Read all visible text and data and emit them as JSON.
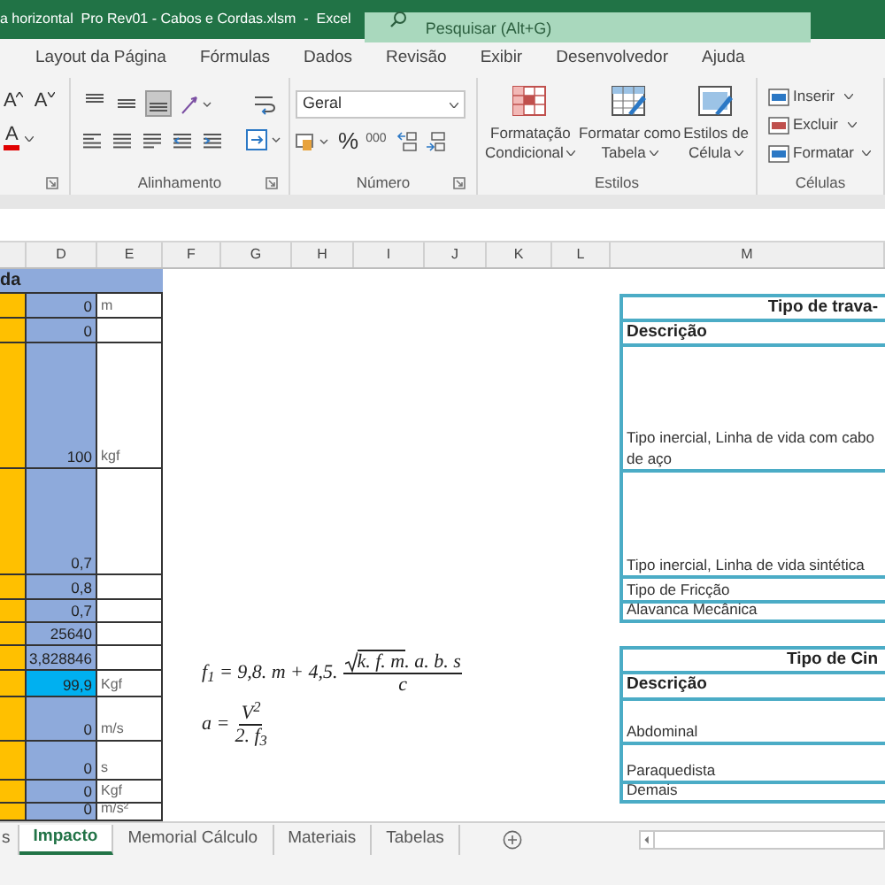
{
  "title_bar": {
    "title": "a horizontal  Pro Rev01 - Cabos e Cordas.xlsm  -  Excel",
    "search": {
      "placeholder": "Pesquisar (Alt+G)"
    }
  },
  "ribbon_tabs": [
    {
      "label": "Layout da Página",
      "selected": false
    },
    {
      "label": "Fórmulas",
      "selected": false
    },
    {
      "label": "Dados",
      "selected": false
    },
    {
      "label": "Revisão",
      "selected": false
    },
    {
      "label": "Exibir",
      "selected": false
    },
    {
      "label": "Desenvolvedor",
      "selected": false
    },
    {
      "label": "Ajuda",
      "selected": false
    }
  ],
  "ribbon": {
    "font_group": {
      "buttons": [
        {
          "kind": "grow",
          "glyph": "A"
        },
        {
          "kind": "shrink",
          "glyph": "A"
        },
        {
          "kind": "color",
          "glyph": "A"
        }
      ]
    },
    "alignment_group": {
      "label": "Alinhamento",
      "vertical_align": [
        {
          "kind": "top",
          "pressed": false
        },
        {
          "kind": "middle",
          "pressed": false
        },
        {
          "kind": "bottom",
          "pressed": true
        }
      ]
    },
    "number_group": {
      "label": "Número",
      "format": "Geral",
      "percent": "%",
      "thousands": "000"
    },
    "styles_group": {
      "label": "Estilos",
      "buttons": [
        {
          "kind": "conditional",
          "line1": "Formatação",
          "line2": "Condicional"
        },
        {
          "kind": "table",
          "line1": "Formatar como",
          "line2": "Tabela"
        },
        {
          "kind": "cell",
          "line1": "Estilos de",
          "line2": "Célula"
        }
      ]
    },
    "cells_group": {
      "label": "Células",
      "buttons": [
        {
          "kind": "insert",
          "label": "Inserir"
        },
        {
          "kind": "delete",
          "label": "Excluir"
        },
        {
          "kind": "format",
          "label": "Formatar"
        }
      ]
    }
  },
  "column_headers": [
    "D",
    "E",
    "F",
    "G",
    "H",
    "I",
    "J",
    "K",
    "L",
    "M"
  ],
  "left_table": {
    "header": "da",
    "rows": [
      {
        "value": "0",
        "unit": "m",
        "highlighted": false
      },
      {
        "value": "0",
        "highlighted": false
      },
      {
        "value": "100",
        "unit": "kgf",
        "highlighted": false
      },
      {
        "value": "0,7",
        "highlighted": false
      },
      {
        "value": "0,8",
        "highlighted": false
      },
      {
        "value": "0,7",
        "highlighted": false
      },
      {
        "value": "25640",
        "highlighted": false
      },
      {
        "value": "3,828846",
        "highlighted": false
      },
      {
        "value": "99,9",
        "unit": "Kgf",
        "highlighted": true
      },
      {
        "value": "0",
        "unit": "m/s",
        "highlighted": false
      },
      {
        "value": "0",
        "unit": "s",
        "highlighted": false
      },
      {
        "value": "0",
        "unit": "Kgf",
        "highlighted": false
      },
      {
        "value": "0",
        "unit": "m/s²",
        "highlighted": false
      }
    ]
  },
  "formulas": [
    {
      "kind": "root_fraction",
      "lead": "f$_{1}$ = 9,8. m + 4,5.",
      "radicand": "k. f. m",
      "tail": ". a. b. s",
      "denominator": "c"
    },
    {
      "kind": "fraction",
      "lead": "a =",
      "numerator": "V$^{2}$",
      "denominator": "2. f$_{3}$"
    }
  ],
  "lookup_tables": [
    {
      "title": "Tipo de trava-",
      "header": "Descrição",
      "rows": [
        "Tipo inercial, Linha de vida com cabo de aço",
        "Tipo inercial, Linha de vida sintética",
        "Tipo de Fricção",
        "Alavanca Mecânica"
      ]
    },
    {
      "title": "Tipo de Cin",
      "header": "Descrição",
      "rows": [
        "Abdominal",
        "Paraquedista",
        "Demais"
      ]
    }
  ],
  "sheet_tabs": [
    {
      "label": "s",
      "selected": false
    },
    {
      "label": "Impacto",
      "selected": true
    },
    {
      "label": "Memorial Cálculo",
      "selected": false
    },
    {
      "label": "Materiais",
      "selected": false
    },
    {
      "label": "Tabelas",
      "selected": false
    }
  ]
}
